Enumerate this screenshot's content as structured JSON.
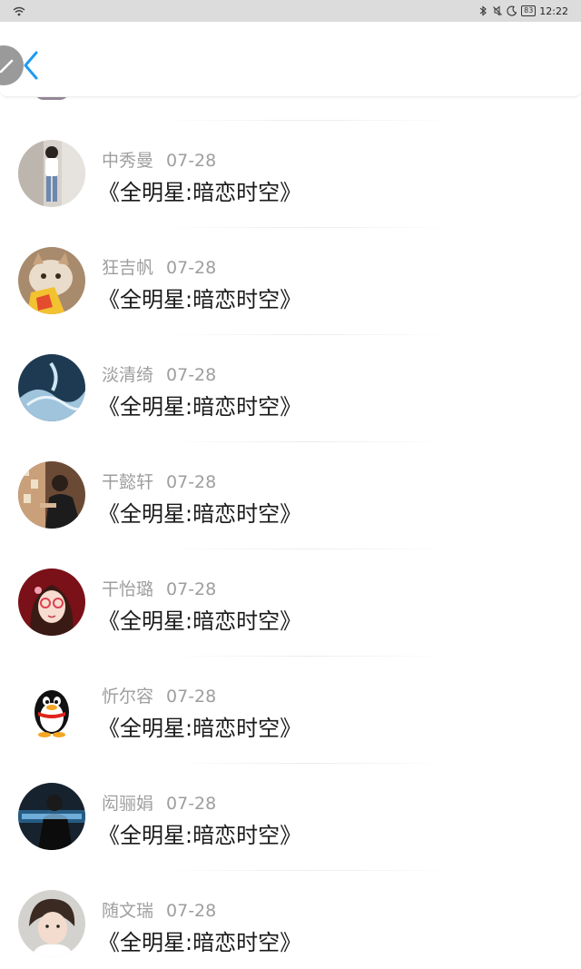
{
  "status_bar": {
    "battery": "83",
    "time": "12:22"
  },
  "header": {
    "back_icon": "chevron-left-icon",
    "edit_icon": "pencil-icon"
  },
  "colors": {
    "accent": "#1e9bf0",
    "name_gray": "#9e9e9e",
    "text": "#1a1a1a"
  },
  "items": [
    {
      "name": "中秀曼",
      "date": "07-28",
      "message": "《全明星:暗恋时空》",
      "avatar": "avatar-photo-woman"
    },
    {
      "name": "狂吉帆",
      "date": "07-28",
      "message": "《全明星:暗恋时空》",
      "avatar": "avatar-cat"
    },
    {
      "name": "淡清绮",
      "date": "07-28",
      "message": "《全明星:暗恋时空》",
      "avatar": "avatar-blue-art"
    },
    {
      "name": "干懿轩",
      "date": "07-28",
      "message": "《全明星:暗恋时空》",
      "avatar": "avatar-photo-man"
    },
    {
      "name": "干怡璐",
      "date": "07-28",
      "message": "《全明星:暗恋时空》",
      "avatar": "avatar-cartoon-girl"
    },
    {
      "name": "忻尔容",
      "date": "07-28",
      "message": "《全明星:暗恋时空》",
      "avatar": "avatar-qq-penguin"
    },
    {
      "name": "闳骊娟",
      "date": "07-28",
      "message": "《全明星:暗恋时空》",
      "avatar": "avatar-dark-photo"
    },
    {
      "name": "随文瑞",
      "date": "07-28",
      "message": "《全明星:暗恋时空》",
      "avatar": "avatar-boy-photo"
    }
  ]
}
